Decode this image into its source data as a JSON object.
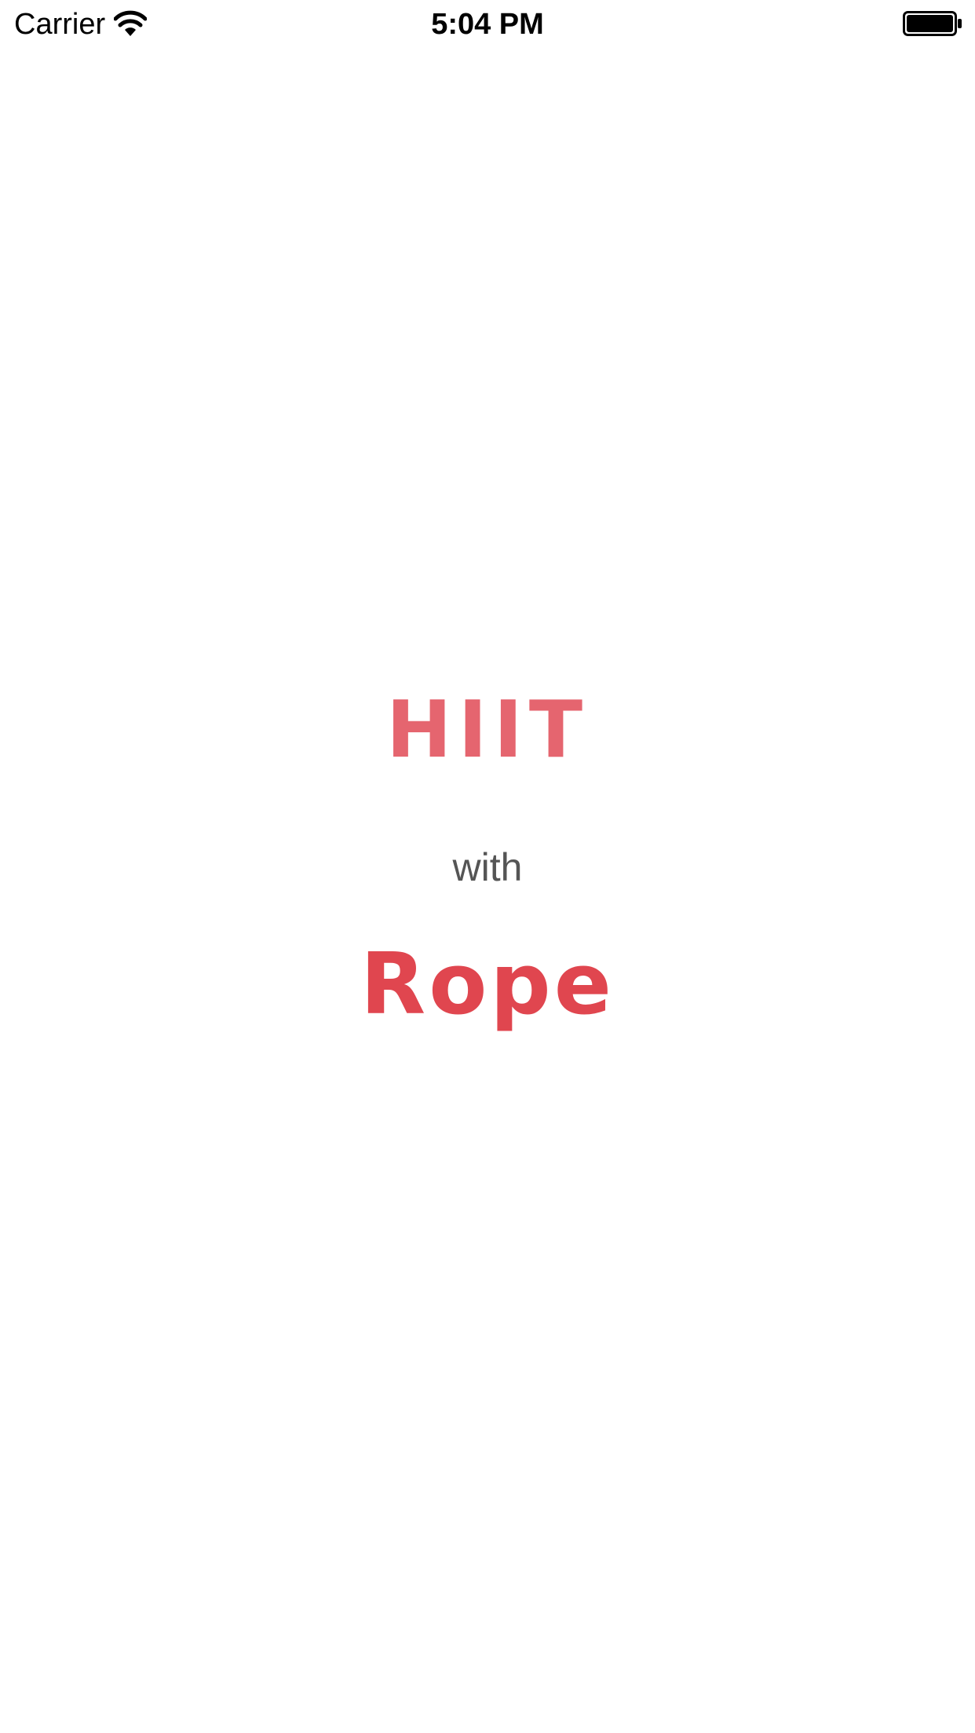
{
  "status_bar": {
    "carrier": "Carrier",
    "time": "5:04 PM",
    "wifi_icon": "wifi-icon",
    "battery_icon": "battery-icon",
    "battery_level": 1.0
  },
  "splash": {
    "line1": "HIIT",
    "line2": "with",
    "line3": "Rope"
  },
  "colors": {
    "hiit": "#e5656f",
    "rope": "#e0464f",
    "with": "#555555",
    "background": "#ffffff"
  }
}
